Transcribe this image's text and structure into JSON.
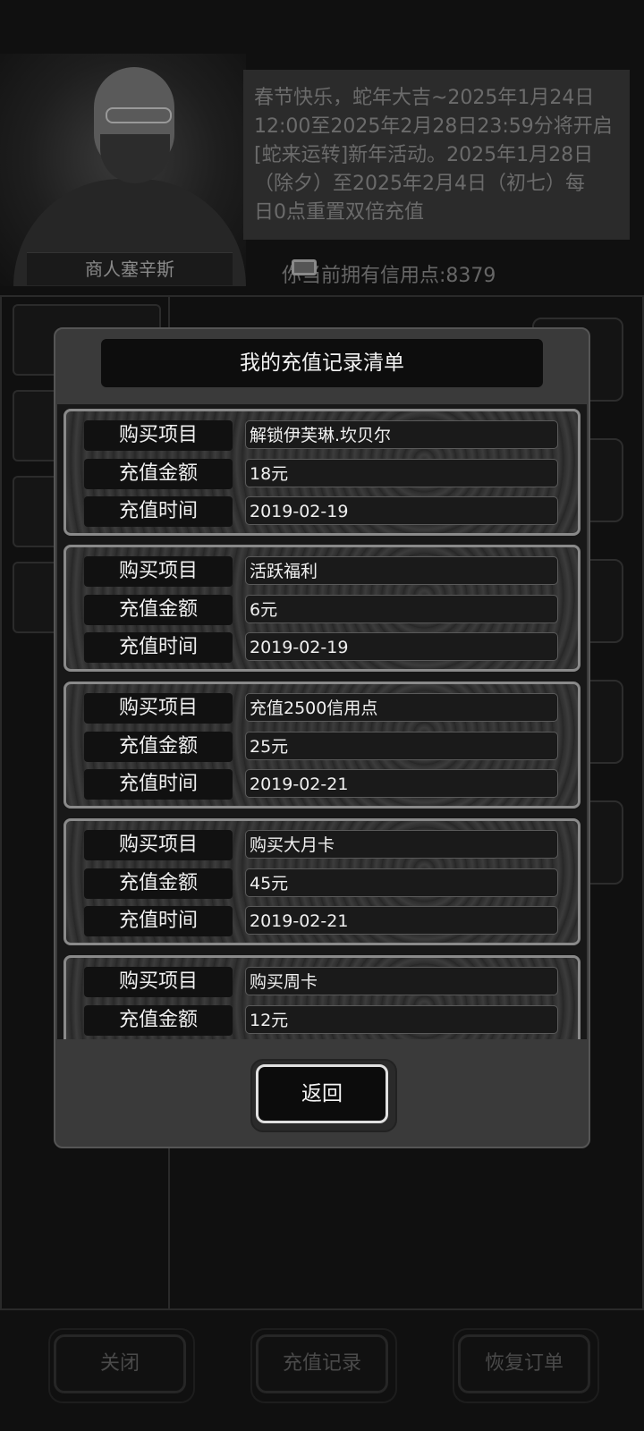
{
  "background": {
    "merchant_name": "商人塞辛斯",
    "notice_lines": [
      "春节快乐，蛇年大吉~2025年1月24日",
      "12:00至2025年2月28日23:59分将开启",
      "[蛇来运转]新年活动。2025年1月28日",
      "（除夕）至2025年2月4日（初七）每",
      "日0点重置双倍充值"
    ],
    "credits_label": "你当前拥有信用点:",
    "credits_value": "8379",
    "bottom_buttons": {
      "close": "关闭",
      "records": "充值记录",
      "restore": "恢复订单"
    }
  },
  "dialog": {
    "title": "我的充值记录清单",
    "back_label": "返回",
    "field_labels": {
      "item": "购买项目",
      "amount": "充值金额",
      "time": "充值时间"
    },
    "records": [
      {
        "item": "解锁伊芙琳.坎贝尔",
        "amount": "18元",
        "time": "2019-02-19"
      },
      {
        "item": "活跃福利",
        "amount": "6元",
        "time": "2019-02-19"
      },
      {
        "item": "充值2500信用点",
        "amount": "25元",
        "time": "2019-02-21"
      },
      {
        "item": "购买大月卡",
        "amount": "45元",
        "time": "2019-02-21"
      },
      {
        "item": "购买周卡",
        "amount": "12元"
      }
    ]
  }
}
